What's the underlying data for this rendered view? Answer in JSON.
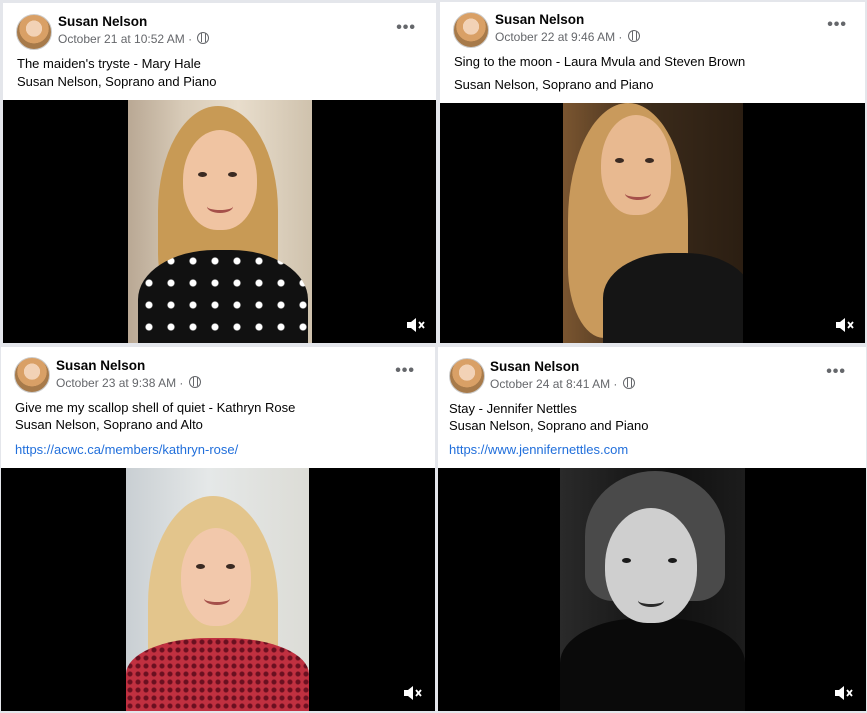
{
  "posts": [
    {
      "author": "Susan Nelson",
      "date": "October 21 at 10:52 AM ·",
      "title": "The maiden's tryste - Mary Hale",
      "subtitle": "Susan Nelson, Soprano and Piano",
      "link": "",
      "more_label": "•••"
    },
    {
      "author": "Susan Nelson",
      "date": "October 22 at 9:46 AM ·",
      "title": "Sing to the moon - Laura Mvula and Steven Brown",
      "subtitle": "Susan Nelson, Soprano and Piano",
      "link": "",
      "more_label": "•••"
    },
    {
      "author": "Susan Nelson",
      "date": "October 23 at 9:38 AM ·",
      "title": "Give me my scallop shell of quiet - Kathryn Rose",
      "subtitle": "Susan Nelson, Soprano and Alto",
      "link": "https://acwc.ca/members/kathryn-rose/",
      "more_label": "•••"
    },
    {
      "author": "Susan Nelson",
      "date": "October 24 at 8:41 AM ·",
      "title": "Stay - Jennifer Nettles",
      "subtitle": "Susan Nelson, Soprano and Piano",
      "link": "https://www.jennifernettles.com",
      "more_label": "•••"
    }
  ],
  "icons": {
    "privacy": "globe-icon",
    "more": "more-options-icon",
    "mute": "muted-speaker-icon"
  },
  "colors": {
    "link": "#216fdb",
    "meta": "#65676b",
    "video_background": "#000000"
  }
}
